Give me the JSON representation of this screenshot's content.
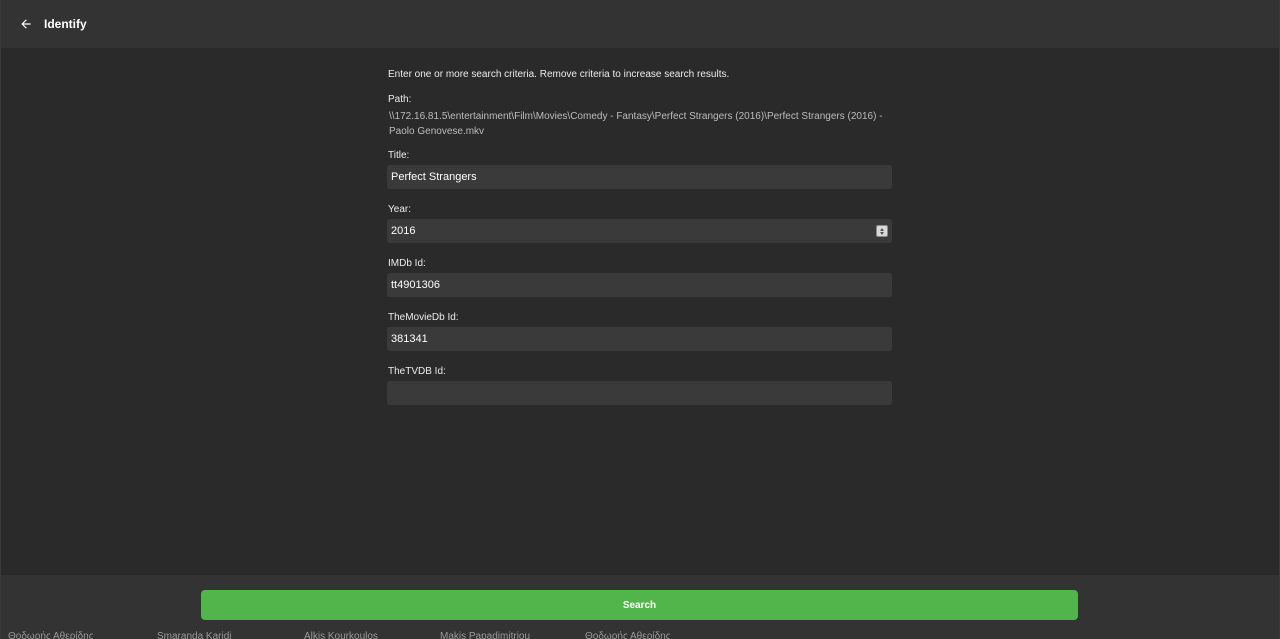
{
  "header": {
    "title": "Identify",
    "back_icon": "arrow-left-icon"
  },
  "form": {
    "intro": "Enter one or more search criteria. Remove criteria to increase search results.",
    "path_label": "Path:",
    "path_value": "\\\\172.16.81.5\\entertainment\\Film\\Movies\\Comedy - Fantasy\\Perfect Strangers (2016)\\Perfect Strangers (2016) - Paolo Genovese.mkv",
    "title_label": "Title:",
    "title_value": "Perfect Strangers",
    "year_label": "Year:",
    "year_value": "2016",
    "imdb_label": "IMDb Id:",
    "imdb_value": "tt4901306",
    "tmdb_label": "TheMovieDb Id:",
    "tmdb_value": "381341",
    "tvdb_label": "TheTVDB Id:",
    "tvdb_value": ""
  },
  "footer": {
    "search_label": "Search",
    "accent_color": "#52b54b"
  },
  "background_names": [
    "Θοδωρής Αθερίδης",
    "Smaranda Karidi",
    "Alkis Kourkoulos",
    "Makis Papadimitriou",
    "Θοδωρής Αθερίδης"
  ]
}
